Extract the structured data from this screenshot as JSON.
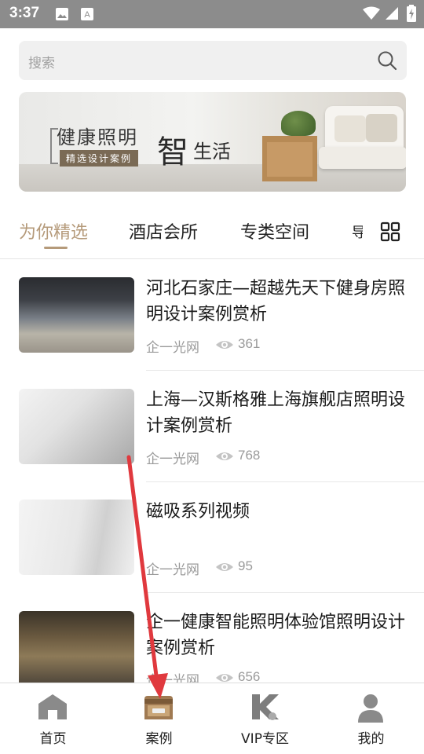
{
  "status_bar": {
    "time": "3:37"
  },
  "search": {
    "placeholder": "搜索"
  },
  "banner": {
    "headline": "健康照明",
    "tag": "精选设计案例",
    "big_char": "智",
    "suffix": "生活"
  },
  "tabs": [
    {
      "label": "为你精选",
      "active": true
    },
    {
      "label": "酒店会所"
    },
    {
      "label": "专类空间"
    },
    {
      "label": "导"
    }
  ],
  "articles": [
    {
      "title": "河北石家庄—超越先天下健身房照明设计案例赏析",
      "source": "企一光网",
      "views": "361"
    },
    {
      "title": "上海—汉斯格雅上海旗舰店照明设计案例赏析",
      "source": "企一光网",
      "views": "768"
    },
    {
      "title": "磁吸系列视频",
      "source": "企一光网",
      "views": "95"
    },
    {
      "title": "企一健康智能照明体验馆照明设计案例赏析",
      "source": "企一光网",
      "views": "656"
    }
  ],
  "bottom_nav": [
    {
      "label": "首页"
    },
    {
      "label": "案例"
    },
    {
      "label": "VIP专区"
    },
    {
      "label": "我的"
    }
  ],
  "colors": {
    "accent": "#b59a7a",
    "annotation_arrow": "#e0393e"
  }
}
